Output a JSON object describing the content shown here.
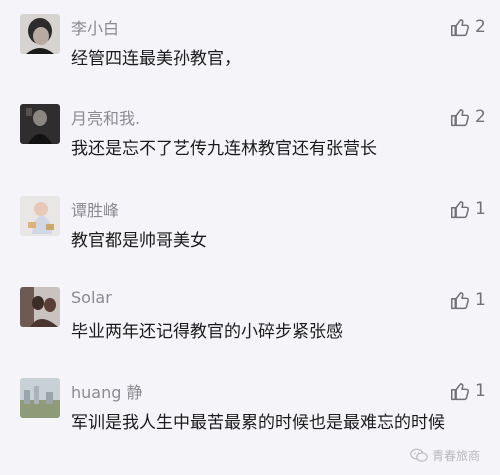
{
  "comments": [
    {
      "username": "李小白",
      "text": "经管四连最美孙教官，",
      "likes": "2"
    },
    {
      "username": "月亮和我.",
      "text": "我还是忘不了艺传九连林教官还有张营长",
      "likes": "2"
    },
    {
      "username": "谭胜峰",
      "text": "教官都是帅哥美女",
      "likes": "1"
    },
    {
      "username": "Solar",
      "text": "毕业两年还记得教官的小碎步紧张感",
      "likes": "1"
    },
    {
      "username": "huang 静",
      "text": "军训是我人生中最苦最累的时候也是最难忘的时候",
      "likes": "1"
    }
  ],
  "watermark": {
    "text": "青春旅商"
  },
  "icons": {
    "like": "thumbs-up-icon",
    "watermark": "wechat-icon"
  }
}
